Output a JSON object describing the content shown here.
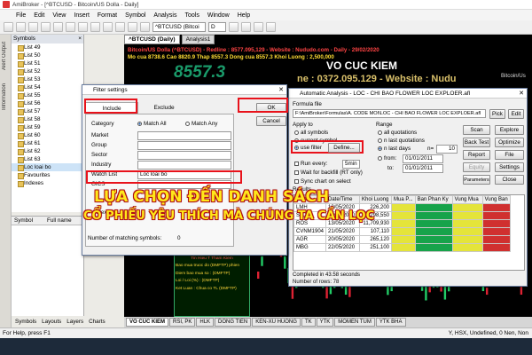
{
  "window": {
    "title": "AmiBroker - [^BTCUSD - Bitcoin/US Dolla        - Daily]",
    "menu": [
      "File",
      "Edit",
      "View",
      "Insert",
      "Format",
      "Symbol",
      "Analysis",
      "Tools",
      "Window",
      "Help"
    ]
  },
  "toolbar": {
    "symbol_combo": "^BTCUSD (Bitcoi",
    "interval_combo": "D"
  },
  "side_strip": {
    "tab1": "Alert Output",
    "tab2": "Information"
  },
  "symbols_panel": {
    "title": "Symbols",
    "items": [
      "List 49",
      "List 50",
      "List 51",
      "List 52",
      "List 53",
      "List 54",
      "List 55",
      "List 56",
      "List 57",
      "List 58",
      "List 59",
      "List 60",
      "List 61",
      "List 62",
      "List 63",
      "Loc loai bo",
      "Favourites",
      "Indexes"
    ],
    "columns": [
      "Symbol",
      "Full name"
    ]
  },
  "left_tabs": [
    "Symbols",
    "Layouts",
    "Layers",
    "Charts"
  ],
  "chart": {
    "tabs": [
      "^BTCUSD (Daily)",
      "Analysis1"
    ],
    "line1": "Bitcoin/US Dolla    (^BTCUSD) - Redline : 8577.095,129 - Website : Nududo.com - Daily - 29/02/2020",
    "line2": "Mo cua 8738.6  Cao 8820.9  Thap 8557.3  Dong cua 8557.3  Khoi Luong : 2,500,000",
    "price": "8557.3",
    "watermark_name": "VO CUC KIEM",
    "watermark_phone": "ne : 0372.095.129 - Website : Nudu",
    "right_label": "Bitcoin/Us",
    "bottom_box": [
      "Bao mua than khien ^BTCUSD la : 9425.4",
      "Lo / Loi (%) : 2.521.10 (Nghien dong)",
      "Tin Hieu T Tham Kiem",
      "Bao mua truoc do (DMFTP) phien",
      "Diem bao mua so : (DMFTP)",
      "Loi / Loi (%) : (DMFTP)",
      "Ket Luan : Chua co TL (DMFTP)"
    ],
    "bottom_tabs": [
      "VO CUC KIEM",
      "RSI, PK",
      "HLK",
      "DONG TIEN",
      "KEN-XU HUONG",
      "TK",
      "YTK",
      "MOMEN TUM",
      "YTK BHA"
    ]
  },
  "filter_dialog": {
    "title": "Filter settings",
    "tab_include": "Include",
    "tab_exclude": "Exclude",
    "ok": "OK",
    "cancel": "Cancel",
    "category_label": "Category",
    "match_all": "Match All",
    "match_any": "Match Any",
    "rows": [
      {
        "label": "Market",
        "value": ""
      },
      {
        "label": "Group",
        "value": ""
      },
      {
        "label": "Sector",
        "value": ""
      },
      {
        "label": "Industry",
        "value": ""
      },
      {
        "label": "Watch List",
        "value": "Loc loai bo"
      },
      {
        "label": "GICS",
        "value": ""
      }
    ],
    "index_row": "Index",
    "matching_label": "Number of matching symbols:",
    "matching_count": "0"
  },
  "analysis_dialog": {
    "title": "Automatic Analysis - LOC - CHI BAO FLOWER LOC EXPLOER.afl",
    "formula_file_label": "Formula file",
    "formula_path": "F:\\AmiBroker\\Formulas\\A. CODE MOI\\LOC - CHI BAO FLOWER LOC EXPLOER.afl",
    "pick": "Pick",
    "edit": "Edit",
    "apply_to": "Apply to",
    "all_symbols": "all symbols",
    "current_symbol": "current symbol",
    "use_filter": "use filter",
    "define": "Define...",
    "range": "Range",
    "all_quotations": "all quotations",
    "last_quotations": "n last quotations",
    "last_days": "n last days",
    "n_label": "n=",
    "n_value": "10",
    "from_label": "from:",
    "from_date": "01/01/2011",
    "to_label": "to:",
    "to_date": "01/01/2011",
    "run_every": "Run every:",
    "run_every_value": "5min",
    "wait_backfill": "Wait for backfill (RT only)",
    "sync_chart": "Sync chart on select",
    "buttons": [
      "Scan",
      "Explore",
      "Back Test",
      "Optimize",
      "Report",
      "File",
      "Equity",
      "Parameters",
      "Settings",
      "Close"
    ],
    "results_label": "Results",
    "table": {
      "headers": [
        "Ticker",
        "Date/Time",
        "Khoi Luong",
        "Mua P...",
        "Ban Phan Ky",
        "Vung Mua",
        "Vung Ban"
      ],
      "rows": [
        [
          "LMH",
          "13/05/2020",
          "226,200"
        ],
        [
          "SJC",
          "21/05/2020",
          "298,550"
        ],
        [
          "ROS",
          "13/05/2020",
          "11,709,930"
        ],
        [
          "CVNM1904",
          "21/05/2020",
          "107,110"
        ],
        [
          "AGR",
          "20/05/2020",
          "265,120"
        ],
        [
          "MBG",
          "22/05/2020",
          "251,100"
        ]
      ]
    },
    "completed": "Completed in 43.58 seconds",
    "num_rows": "Number of rows: 78"
  },
  "overlay": {
    "line1": "LỰA CHỌN ĐẾN DANH SÁCH",
    "line2": "CỔ PHIẾU YÊU THÍCH MÀ CHÚNG TA CẦN LỌC"
  },
  "status": {
    "left": "For Help, press F1",
    "right": "Y, HSX, Undefined, 0 Nen, Non"
  },
  "colors": {
    "highlight": "#e8121b",
    "overlay_text": "#ffe81a",
    "chart_bg": "#000000",
    "bar_green": "#17a34a",
    "bar_yellow": "#e4e43a",
    "bar_red": "#d0302f"
  }
}
